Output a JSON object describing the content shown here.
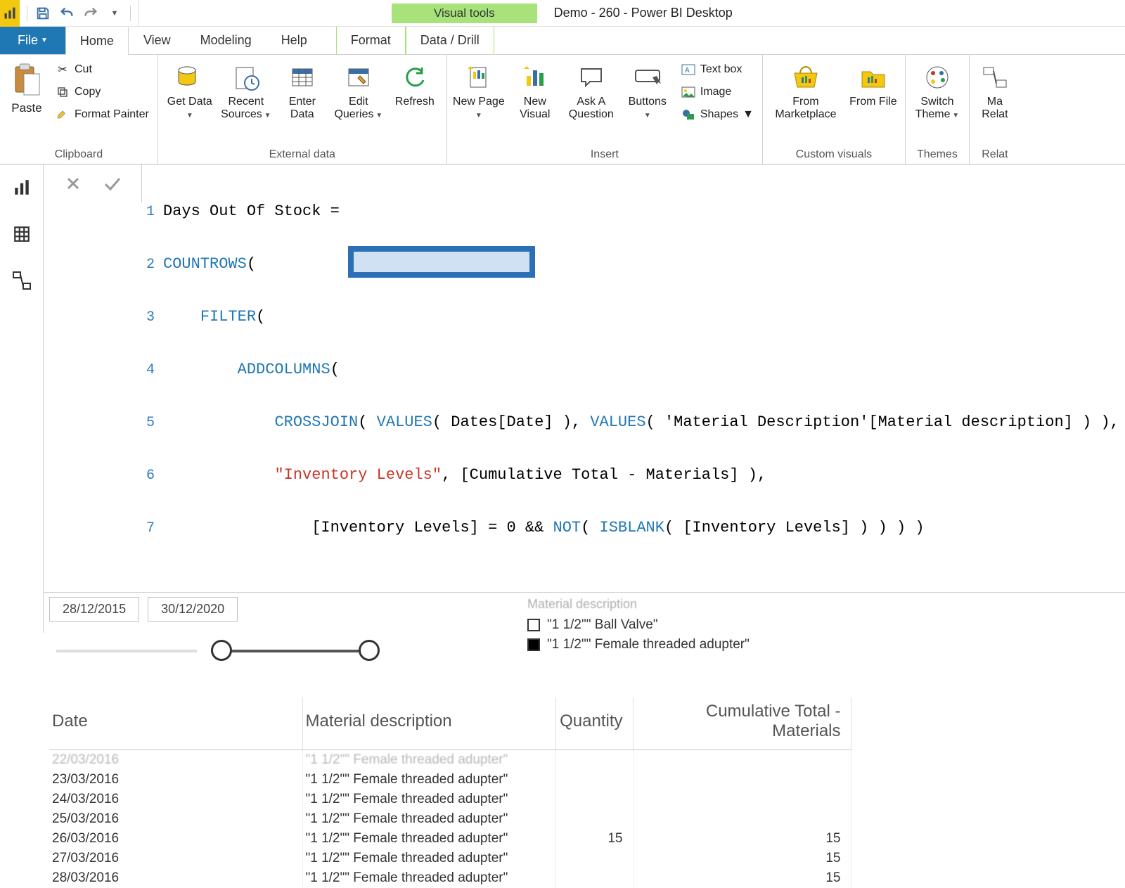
{
  "titlebar": {
    "visual_tools": "Visual tools",
    "app_title": "Demo - 260 - Power BI Desktop"
  },
  "tabs": {
    "file": "File",
    "home": "Home",
    "view": "View",
    "modeling": "Modeling",
    "help": "Help",
    "format": "Format",
    "data_drill": "Data / Drill"
  },
  "ribbon": {
    "clipboard": {
      "label": "Clipboard",
      "paste": "Paste",
      "cut": "Cut",
      "copy": "Copy",
      "format_painter": "Format Painter"
    },
    "external": {
      "label": "External data",
      "get_data": "Get Data",
      "recent_sources": "Recent Sources",
      "enter_data": "Enter Data",
      "edit_queries": "Edit Queries",
      "refresh": "Refresh"
    },
    "insert": {
      "label": "Insert",
      "new_page": "New Page",
      "new_visual": "New Visual",
      "ask": "Ask A Question",
      "buttons": "Buttons",
      "textbox": "Text box",
      "image": "Image",
      "shapes": "Shapes"
    },
    "custom": {
      "label": "Custom visuals",
      "marketplace": "From Marketplace",
      "file": "From File"
    },
    "themes": {
      "label": "Themes",
      "switch": "Switch Theme"
    },
    "relationships": {
      "label": "Relat",
      "manage_short": "Ma",
      "manage_line2": "Relat"
    }
  },
  "formula": {
    "lines": [
      "Days Out Of Stock = ",
      "COUNTROWS(",
      "    FILTER(",
      "        ADDCOLUMNS(",
      "            CROSSJOIN( VALUES( Dates[Date] ), VALUES( 'Material Description'[Material description] ) ),",
      "            \"Inventory Levels\", [Cumulative Total - Materials] ),",
      "                [Inventory Levels] = 0 && NOT( ISBLANK( [Inventory Levels] ) ) ) )"
    ]
  },
  "slicer": {
    "from": "28/12/2015",
    "to": "30/12/2020"
  },
  "legend": {
    "title": "Material description",
    "items": [
      {
        "label": "\"1 1/2\"\" Ball Valve\"",
        "filled": false
      },
      {
        "label": "\"1 1/2\"\" Female threaded adupter\"",
        "filled": true
      }
    ]
  },
  "table": {
    "headers": {
      "date": "Date",
      "desc": "Material description",
      "qty": "Quantity",
      "cum": "Cumulative Total - Materials"
    },
    "rows": [
      {
        "date": "22/03/2016",
        "desc": "\"1 1/2\"\" Female threaded adupter\"",
        "qty": "",
        "cum": "",
        "faded": true
      },
      {
        "date": "23/03/2016",
        "desc": "\"1 1/2\"\" Female threaded adupter\"",
        "qty": "",
        "cum": ""
      },
      {
        "date": "24/03/2016",
        "desc": "\"1 1/2\"\" Female threaded adupter\"",
        "qty": "",
        "cum": ""
      },
      {
        "date": "25/03/2016",
        "desc": "\"1 1/2\"\" Female threaded adupter\"",
        "qty": "",
        "cum": ""
      },
      {
        "date": "26/03/2016",
        "desc": "\"1 1/2\"\" Female threaded adupter\"",
        "qty": "15",
        "cum": "15"
      },
      {
        "date": "27/03/2016",
        "desc": "\"1 1/2\"\" Female threaded adupter\"",
        "qty": "",
        "cum": "15"
      },
      {
        "date": "28/03/2016",
        "desc": "\"1 1/2\"\" Female threaded adupter\"",
        "qty": "",
        "cum": "15"
      }
    ]
  }
}
